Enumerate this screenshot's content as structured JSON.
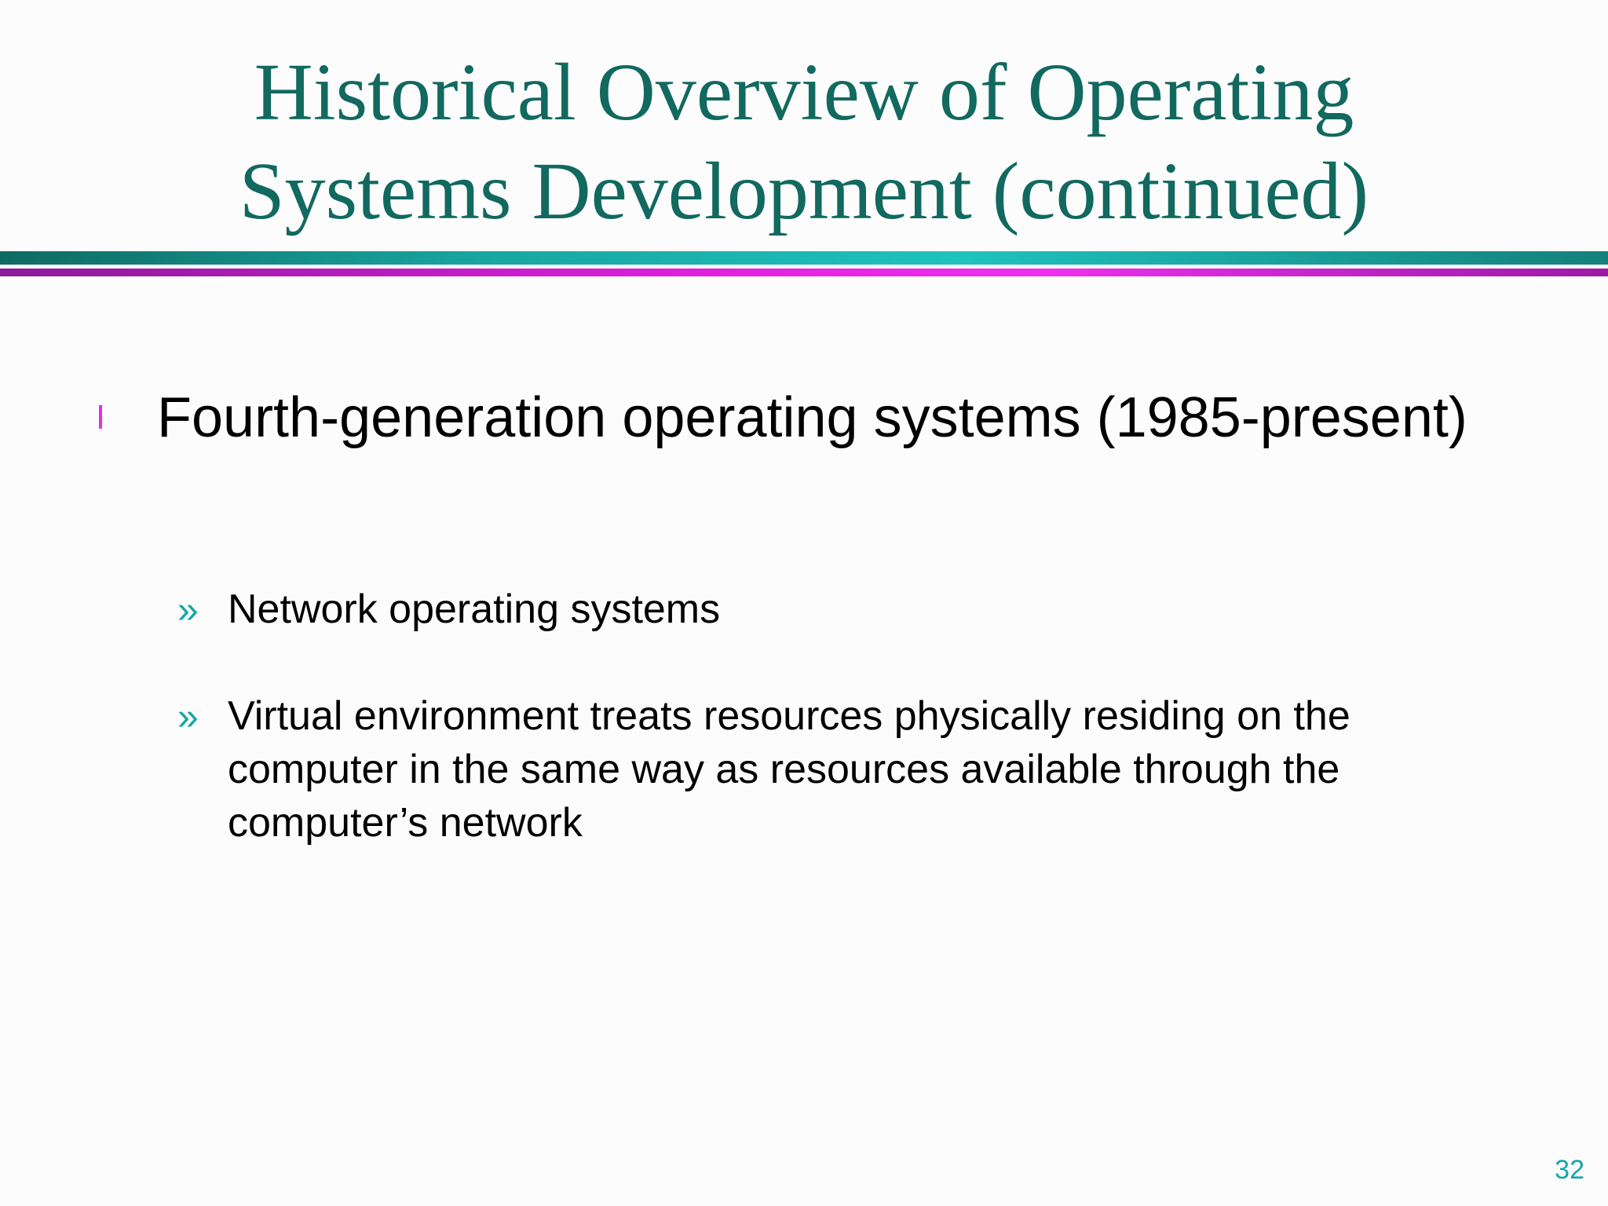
{
  "slide": {
    "title_line1": "Historical Overview of Operating",
    "title_line2": "Systems Development (continued)",
    "bullet": {
      "marker": "l",
      "text": "Fourth-generation operating systems (1985-present)"
    },
    "sub_bullets": [
      {
        "marker": "»",
        "text": "Network operating systems"
      },
      {
        "marker": "»",
        "text": "Virtual environment treats resources physically residing on the computer in the same way as resources available through the computer’s network"
      }
    ],
    "page_number": "32"
  },
  "colors": {
    "title": "#11695f",
    "accent_teal": "#15a7a5",
    "accent_magenta": "#e52fe1",
    "background": "#fcfcfc"
  }
}
